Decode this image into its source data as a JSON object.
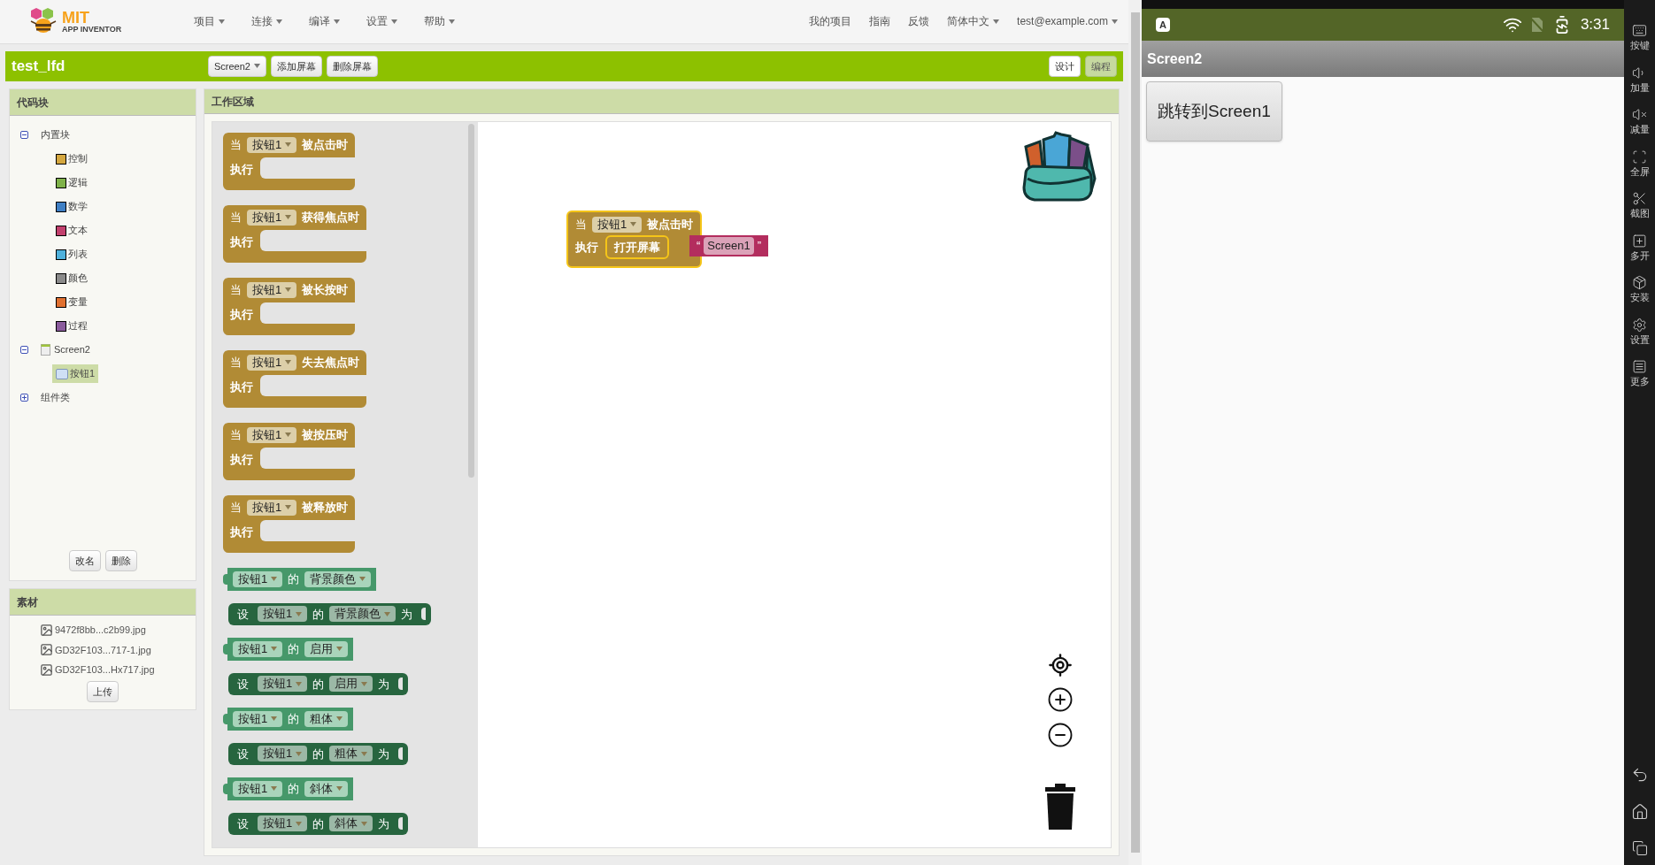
{
  "header": {
    "logo": {
      "title": "MIT",
      "subtitle": "APP INVENTOR"
    },
    "menus": [
      "项目",
      "连接",
      "编译",
      "设置",
      "帮助"
    ],
    "links": [
      "我的项目",
      "指南",
      "反馈"
    ],
    "language": "简体中文",
    "account": "test@example.com"
  },
  "project": {
    "title": "test_lfd",
    "screen": "Screen2",
    "actions": [
      "添加屏幕",
      "删除屏幕"
    ],
    "views": [
      {
        "label": "设计",
        "selected": false
      },
      {
        "label": "编程",
        "selected": true
      }
    ]
  },
  "blocks_panel": {
    "title": "代码块",
    "tree": [
      {
        "label": "内置块",
        "kind": "group",
        "expanded": true,
        "selected": false,
        "children": [
          {
            "label": "控制",
            "kind": "category",
            "color": "#d4a73f",
            "selected": false
          },
          {
            "label": "逻辑",
            "kind": "category",
            "color": "#7fb24a",
            "selected": false
          },
          {
            "label": "数学",
            "kind": "category",
            "color": "#3f7fc4",
            "selected": false
          },
          {
            "label": "文本",
            "kind": "category",
            "color": "#c2406d",
            "selected": false
          },
          {
            "label": "列表",
            "kind": "category",
            "color": "#4fb1dc",
            "selected": false
          },
          {
            "label": "颜色",
            "kind": "category",
            "color": "#8a8a8a",
            "selected": false
          },
          {
            "label": "变量",
            "kind": "category",
            "color": "#e07030",
            "selected": false
          },
          {
            "label": "过程",
            "kind": "category",
            "color": "#8a5b9c",
            "selected": false
          }
        ]
      },
      {
        "label": "Screen2",
        "kind": "screen",
        "expanded": true,
        "selected": false,
        "children": [
          {
            "label": "按钮1",
            "kind": "component",
            "selected": true
          }
        ]
      },
      {
        "label": "组件类",
        "kind": "group",
        "expanded": false,
        "selected": false
      }
    ],
    "buttons": [
      "改名",
      "删除"
    ]
  },
  "media": {
    "title": "素材",
    "files": [
      "9472f8bb...c2b99.jpg",
      "GD32F103...717-1.jpg",
      "GD32F103...Hx717.jpg"
    ],
    "upload": "上传"
  },
  "workspace": {
    "title": "工作区域",
    "flyout": [
      {
        "kind": "event",
        "when": "当",
        "component": "按钮1",
        "event": "被点击时",
        "do": "执行"
      },
      {
        "kind": "event",
        "when": "当",
        "component": "按钮1",
        "event": "获得焦点时",
        "do": "执行"
      },
      {
        "kind": "event",
        "when": "当",
        "component": "按钮1",
        "event": "被长按时",
        "do": "执行"
      },
      {
        "kind": "event",
        "when": "当",
        "component": "按钮1",
        "event": "失去焦点时",
        "do": "执行"
      },
      {
        "kind": "event",
        "when": "当",
        "component": "按钮1",
        "event": "被按压时",
        "do": "执行"
      },
      {
        "kind": "event",
        "when": "当",
        "component": "按钮1",
        "event": "被释放时",
        "do": "执行"
      },
      {
        "kind": "getter",
        "component": "按钮1",
        "of": "的",
        "property": "背景颜色"
      },
      {
        "kind": "setter",
        "set": "设",
        "component": "按钮1",
        "of": "的",
        "property": "背景颜色",
        "to": "为"
      },
      {
        "kind": "getter",
        "component": "按钮1",
        "of": "的",
        "property": "启用"
      },
      {
        "kind": "setter",
        "set": "设",
        "component": "按钮1",
        "of": "的",
        "property": "启用",
        "to": "为"
      },
      {
        "kind": "getter",
        "component": "按钮1",
        "of": "的",
        "property": "粗体"
      },
      {
        "kind": "setter",
        "set": "设",
        "component": "按钮1",
        "of": "的",
        "property": "粗体",
        "to": "为"
      },
      {
        "kind": "getter",
        "component": "按钮1",
        "of": "的",
        "property": "斜体"
      },
      {
        "kind": "setter",
        "set": "设",
        "component": "按钮1",
        "of": "的",
        "property": "斜体",
        "to": "为"
      }
    ],
    "canvas_block": {
      "when": "当",
      "component": "按钮1",
      "event": "被点击时",
      "do": "执行",
      "action": "打开屏幕",
      "quote_open": "“",
      "value": "Screen1",
      "quote_close": "”"
    }
  },
  "phone": {
    "notification": "A",
    "time": "3:31",
    "app_title": "Screen2",
    "button": "跳转到Screen1",
    "tools": [
      "按键",
      "加量",
      "减量",
      "全屏",
      "截图",
      "多开",
      "安装",
      "设置",
      "更多"
    ]
  }
}
